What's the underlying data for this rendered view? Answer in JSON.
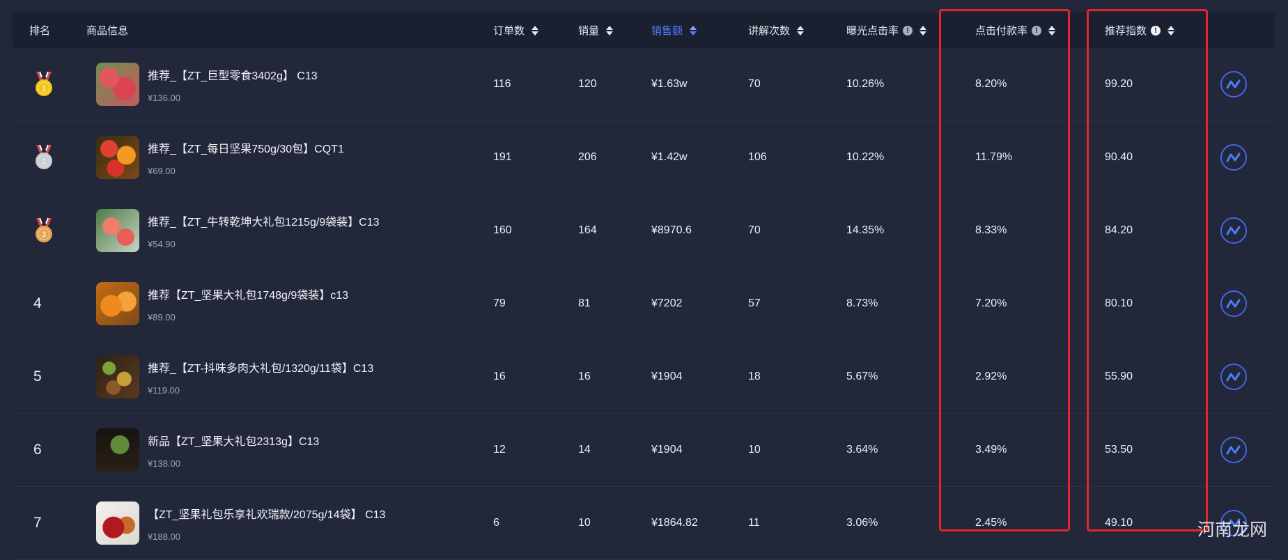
{
  "headers": {
    "rank": "排名",
    "product": "商品信息",
    "orders": "订单数",
    "sales": "销量",
    "revenue": "销售额",
    "explain": "讲解次数",
    "ctr": "曝光点击率",
    "cvr": "点击付款率",
    "score": "推荐指数"
  },
  "colors": {
    "accent": "#4f7cff",
    "highlight_box": "#e8232a",
    "gold": "#f3c318",
    "silver": "#c9ccd3",
    "bronze": "#e3a253"
  },
  "rows": [
    {
      "rank": "1",
      "medal": "gold",
      "name": "推荐_【ZT_巨型零食3402g】 C13",
      "price": "¥136.00",
      "orders": "116",
      "sales": "120",
      "revenue": "¥1.63w",
      "explain": "70",
      "ctr": "10.26%",
      "cvr": "8.20%",
      "score": "99.20"
    },
    {
      "rank": "2",
      "medal": "silver",
      "name": "推荐_【ZT_每日坚果750g/30包】CQT1",
      "price": "¥69.00",
      "orders": "191",
      "sales": "206",
      "revenue": "¥1.42w",
      "explain": "106",
      "ctr": "10.22%",
      "cvr": "11.79%",
      "score": "90.40"
    },
    {
      "rank": "3",
      "medal": "bronze",
      "name": "推荐_【ZT_牛转乾坤大礼包1215g/9袋装】C13",
      "price": "¥54.90",
      "orders": "160",
      "sales": "164",
      "revenue": "¥8970.6",
      "explain": "70",
      "ctr": "14.35%",
      "cvr": "8.33%",
      "score": "84.20"
    },
    {
      "rank": "4",
      "medal": "",
      "name": "推荐【ZT_坚果大礼包1748g/9袋装】c13",
      "price": "¥89.00",
      "orders": "79",
      "sales": "81",
      "revenue": "¥7202",
      "explain": "57",
      "ctr": "8.73%",
      "cvr": "7.20%",
      "score": "80.10"
    },
    {
      "rank": "5",
      "medal": "",
      "name": "推荐_【ZT-抖味多肉大礼包/1320g/11袋】C13",
      "price": "¥119.00",
      "orders": "16",
      "sales": "16",
      "revenue": "¥1904",
      "explain": "18",
      "ctr": "5.67%",
      "cvr": "2.92%",
      "score": "55.90"
    },
    {
      "rank": "6",
      "medal": "",
      "name": "新品【ZT_坚果大礼包2313g】C13",
      "price": "¥138.00",
      "orders": "12",
      "sales": "14",
      "revenue": "¥1904",
      "explain": "10",
      "ctr": "3.64%",
      "cvr": "3.49%",
      "score": "53.50"
    },
    {
      "rank": "7",
      "medal": "",
      "name": "【ZT_坚果礼包乐享礼欢瑞款/2075g/14袋】 C13",
      "price": "¥188.00",
      "orders": "6",
      "sales": "10",
      "revenue": "¥1864.82",
      "explain": "11",
      "ctr": "3.06%",
      "cvr": "2.45%",
      "score": "49.10"
    }
  ],
  "watermark": "河南龙网"
}
